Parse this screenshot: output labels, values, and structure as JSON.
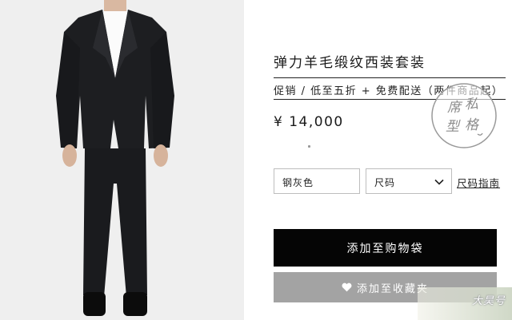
{
  "product": {
    "title": "弹力羊毛缎纹西装套装",
    "promo": "促销 / 低至五折 + 免费配送（两件商品起）",
    "price": "¥ 14,000"
  },
  "stamp": {
    "text": "席私型格"
  },
  "options": {
    "color_value": "钢灰色",
    "size_value": "尺码",
    "size_guide_label": "尺码指南"
  },
  "actions": {
    "add_to_bag": "添加至购物袋",
    "add_to_wishlist": "添加至收藏夹"
  },
  "watermark": {
    "text": "大昊号"
  },
  "colors": {
    "primary_button": "#050505",
    "secondary_button": "#a3a3a3",
    "photo_background": "#efefef"
  },
  "icons": {
    "wishlist": "heart-icon",
    "size_dropdown": "chevron-down-icon"
  }
}
